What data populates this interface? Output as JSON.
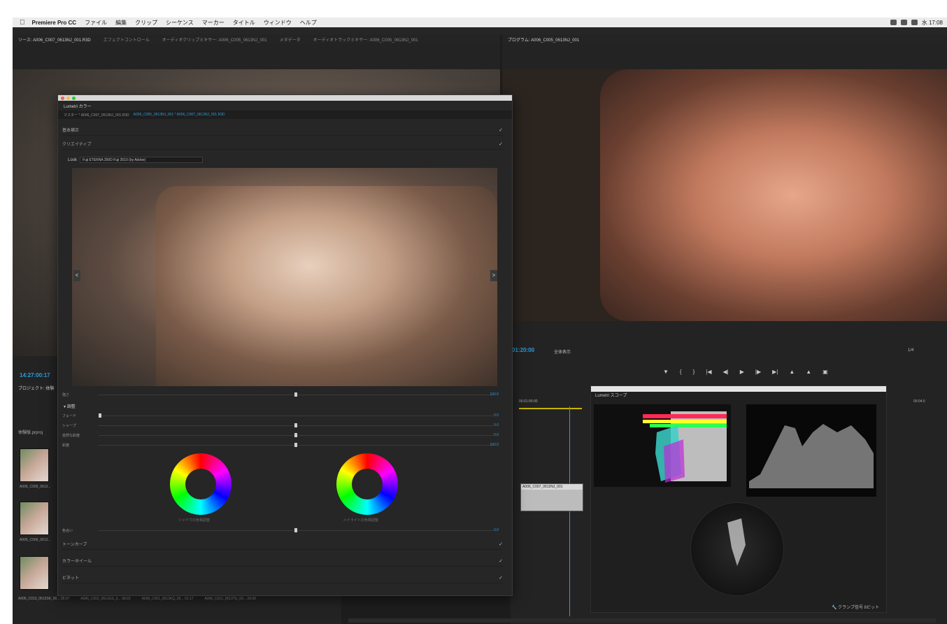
{
  "menubar": {
    "apple": "",
    "app_name": "Premiere Pro CC",
    "items": [
      "ファイル",
      "編集",
      "クリップ",
      "シーケンス",
      "マーカー",
      "タイトル",
      "ウィンドウ",
      "ヘルプ"
    ],
    "clock": "水 17:08"
  },
  "source_panel": {
    "tabs": [
      "ソース: A006_C007_0613NJ_001.R3D",
      "エフェクトコントロール",
      "オーディオクリップミキサー: A006_C005_0613NJ_001",
      "メタデータ",
      "オーディオトラックミキサー: A006_C005_0613NJ_001"
    ],
    "timecode": "14:27:00:17"
  },
  "program_panel": {
    "tab": "プログラム: A006_C005_0613NJ_001",
    "timecode": "01:20:00",
    "zoom": "全体表示",
    "resolution": "1/4"
  },
  "lumetri": {
    "title": "Lumetri カラー",
    "crumb_master": "マスター * A006_C007_0613NJ_001.R3D",
    "crumb_current": "A006_C005_0613NJ_001 * A006_C007_0613NJ_001.R3D",
    "sections": {
      "basic": "基本補正",
      "creative": "クリエイティブ",
      "tone_curve": "トーンカーブ",
      "color_wheels": "カラーホイール",
      "vignette": "ビネット"
    },
    "look_label": "Look",
    "look_value": "Fuji ETERNA 250D Fuji 3510 (by Adobe)",
    "intensity_label": "強さ",
    "intensity_value": "100.0",
    "adjust_label": "調整",
    "sliders": [
      {
        "label": "フェード",
        "value": "0.0",
        "pos": 0.0
      },
      {
        "label": "シャープ",
        "value": "0.0",
        "pos": 0.5
      },
      {
        "label": "自然な彩度",
        "value": "0.0",
        "pos": 0.5
      },
      {
        "label": "彩度",
        "value": "100.0",
        "pos": 0.5
      }
    ],
    "shadow_tint_label": "シャドウの色相調整",
    "highlight_tint_label": "ハイライトの色相調整",
    "tint_balance_label": "色合い",
    "tint_balance_value": "0.0"
  },
  "project_panel": {
    "tab": "プロジェクト: 体験",
    "file": "体験版.prproj",
    "clips": [
      "A006_C005_0613...",
      "A006_C006_0613...",
      "A006_C003_0613..."
    ],
    "bottom_clips": [
      "A006_C013_0613SK_00... 25:07",
      "A006_C002_0613GS_0... 58:03",
      "A006_C001_0613KQ_00... 01:17",
      "A006_C012_0613TU_00... 26:09"
    ]
  },
  "timeline": {
    "timecode_left": "00:01:00:00",
    "timecode_right": "00:04:0",
    "clip_name": "A006_C007_0613NJ_001"
  },
  "scopes": {
    "title": "Lumetri スコープ",
    "footer_clamp": "クランプ信号",
    "footer_bits": "8ビット"
  },
  "colors": {
    "accent": "#2d9cdb",
    "panel_bg": "#232323"
  }
}
